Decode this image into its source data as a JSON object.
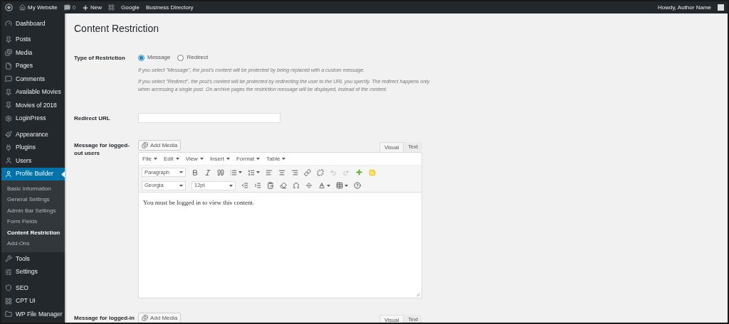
{
  "admin_bar": {
    "site": "My Website",
    "comments": "0",
    "new": "New",
    "links": [
      "Google",
      "Business Directory"
    ],
    "greeting": "Howdy, Author Name"
  },
  "menu_groups": [
    {
      "items": [
        {
          "label": "Dashboard",
          "selected": false
        }
      ]
    },
    {
      "items": [
        {
          "label": "Posts",
          "selected": false
        },
        {
          "label": "Media",
          "selected": false
        },
        {
          "label": "Pages",
          "selected": false
        },
        {
          "label": "Comments",
          "selected": false
        },
        {
          "label": "Available Movies",
          "selected": false
        },
        {
          "label": "Movies of 2018",
          "selected": false
        },
        {
          "label": "LoginPress",
          "selected": false
        }
      ]
    },
    {
      "items": [
        {
          "label": "Appearance",
          "selected": false
        },
        {
          "label": "Plugins",
          "selected": false
        },
        {
          "label": "Users",
          "selected": false
        },
        {
          "label": "Profile Builder",
          "selected": true,
          "children": [
            {
              "label": "Basic Information",
              "selected": false
            },
            {
              "label": "General Settings",
              "selected": false
            },
            {
              "label": "Admin Bar Settings",
              "selected": false
            },
            {
              "label": "Form Fields",
              "selected": false
            },
            {
              "label": "Content Restriction",
              "selected": true
            },
            {
              "label": "Add-Ons",
              "selected": false
            }
          ]
        },
        {
          "label": "Tools",
          "selected": false
        },
        {
          "label": "Settings",
          "selected": false
        }
      ]
    },
    {
      "items": [
        {
          "label": "SEO",
          "selected": false
        },
        {
          "label": "CPT UI",
          "selected": false
        },
        {
          "label": "WP File Manager",
          "selected": false
        }
      ]
    }
  ],
  "page_title": "Content Restriction",
  "fields": [
    {
      "kind": "radio",
      "label": "Type of Restriction",
      "options": [
        {
          "label": "Message",
          "selected": true
        },
        {
          "label": "Redirect",
          "selected": false
        }
      ],
      "descriptions": [
        "If you select \"Message\", the post's content will be protected by being replaced with a custom message.",
        "If you select \"Redirect\", the post's content will be protected by redirecting the user to the URL you specify. The redirect happens only when accessing a single post. On archive pages the restriction message will be displayed, instead of the content."
      ]
    },
    {
      "kind": "text",
      "label": "Redirect URL"
    },
    {
      "kind": "editor",
      "label": "Message for logged-out users",
      "add_media": "Add Media",
      "tabs": [
        {
          "label": "Visual",
          "selected": true
        },
        {
          "label": "Text",
          "selected": false
        }
      ],
      "menus": [
        "File",
        "Edit",
        "View",
        "Insert",
        "Format",
        "Table"
      ],
      "block_format": "Paragraph",
      "font": "Georgia",
      "size": "12pt",
      "content": "You must be logged in to view this content."
    },
    {
      "kind": "editor",
      "label": "Message for logged-in",
      "add_media": "Add Media",
      "tabs": [
        {
          "label": "Visual",
          "selected": true
        },
        {
          "label": "Text",
          "selected": false
        }
      ]
    }
  ]
}
